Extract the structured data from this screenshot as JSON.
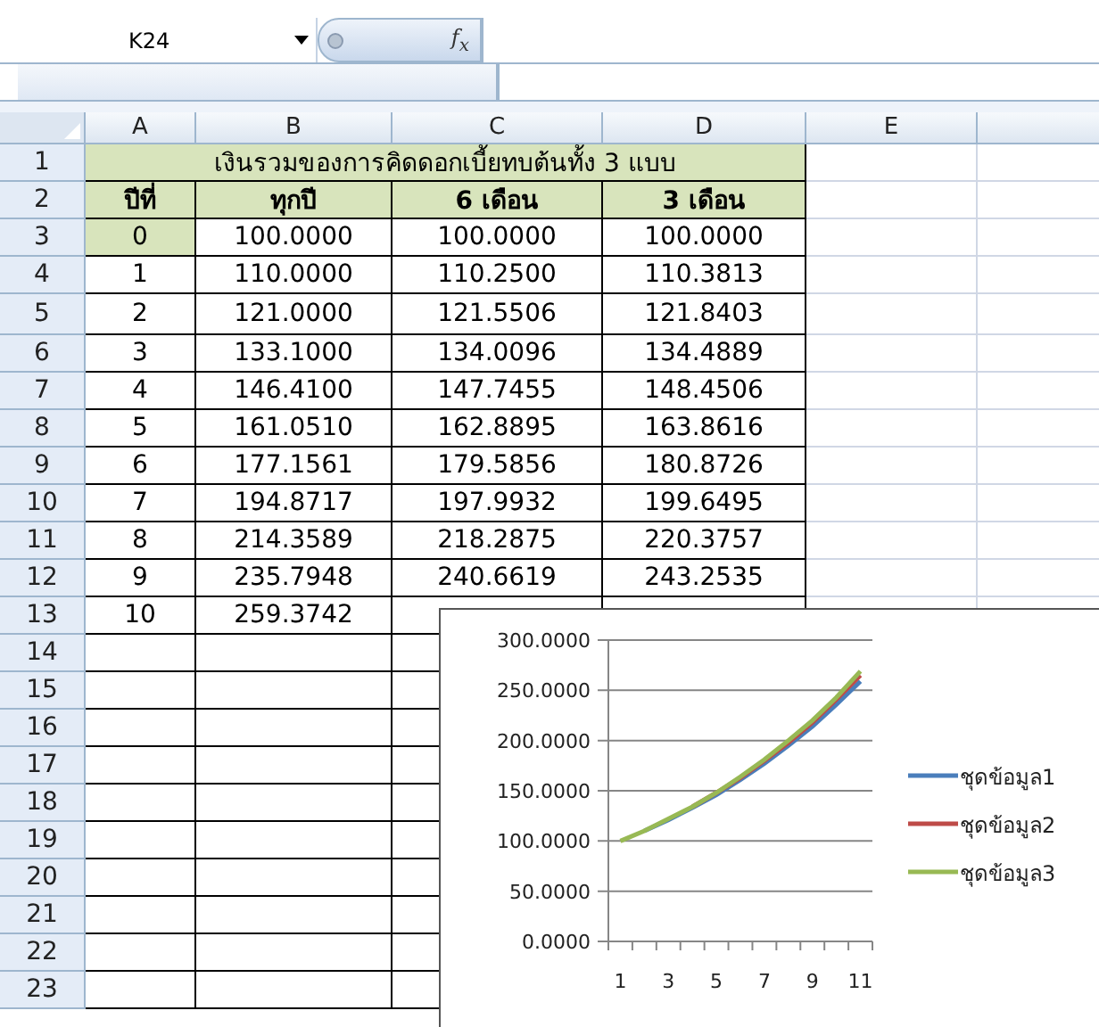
{
  "formula_bar": {
    "name_box": "K24",
    "fx": "f$_{x}$"
  },
  "columns": [
    "A",
    "B",
    "C",
    "D",
    "E",
    ""
  ],
  "rows": [
    {
      "number": "1",
      "kind": "title",
      "title": "เงินรวมของการคิดดอกเบี้ยทบต้นทั้ง 3 แบบ"
    },
    {
      "number": "2",
      "kind": "header",
      "cells": [
        {
          "text": "ปีที่",
          "shaded": true
        },
        {
          "text": "ทุกปี",
          "shaded": true
        },
        {
          "text": "6 เดือน",
          "shaded": true
        },
        {
          "text": "3 เดือน",
          "shaded": true
        }
      ]
    },
    {
      "number": "3",
      "kind": "data",
      "cells": [
        {
          "text": "0",
          "shaded": true
        },
        {
          "text": "100.0000",
          "shaded": false
        },
        {
          "text": "100.0000",
          "shaded": false
        },
        {
          "text": "100.0000",
          "shaded": false
        }
      ]
    },
    {
      "number": "4",
      "kind": "data",
      "cells": [
        {
          "text": "1",
          "shaded": false
        },
        {
          "text": "110.0000",
          "shaded": false
        },
        {
          "text": "110.2500",
          "shaded": false
        },
        {
          "text": "110.3813",
          "shaded": false
        }
      ]
    },
    {
      "number": "5",
      "kind": "data",
      "tall": true,
      "cells": [
        {
          "text": "2",
          "shaded": false
        },
        {
          "text": "121.0000",
          "shaded": false
        },
        {
          "text": "121.5506",
          "shaded": false
        },
        {
          "text": "121.8403",
          "shaded": false
        }
      ]
    },
    {
      "number": "6",
      "kind": "data",
      "cells": [
        {
          "text": "3",
          "shaded": false
        },
        {
          "text": "133.1000",
          "shaded": false
        },
        {
          "text": "134.0096",
          "shaded": false
        },
        {
          "text": "134.4889",
          "shaded": false
        }
      ]
    },
    {
      "number": "7",
      "kind": "data",
      "cells": [
        {
          "text": "4",
          "shaded": false
        },
        {
          "text": "146.4100",
          "shaded": false
        },
        {
          "text": "147.7455",
          "shaded": false
        },
        {
          "text": "148.4506",
          "shaded": false
        }
      ]
    },
    {
      "number": "8",
      "kind": "data",
      "cells": [
        {
          "text": "5",
          "shaded": false
        },
        {
          "text": "161.0510",
          "shaded": false
        },
        {
          "text": "162.8895",
          "shaded": false
        },
        {
          "text": "163.8616",
          "shaded": false
        }
      ]
    },
    {
      "number": "9",
      "kind": "data",
      "cells": [
        {
          "text": "6",
          "shaded": false
        },
        {
          "text": "177.1561",
          "shaded": false
        },
        {
          "text": "179.5856",
          "shaded": false
        },
        {
          "text": "180.8726",
          "shaded": false
        }
      ]
    },
    {
      "number": "10",
      "kind": "data",
      "cells": [
        {
          "text": "7",
          "shaded": false
        },
        {
          "text": "194.8717",
          "shaded": false
        },
        {
          "text": "197.9932",
          "shaded": false
        },
        {
          "text": "199.6495",
          "shaded": false
        }
      ]
    },
    {
      "number": "11",
      "kind": "data",
      "cells": [
        {
          "text": "8",
          "shaded": false
        },
        {
          "text": "214.3589",
          "shaded": false
        },
        {
          "text": "218.2875",
          "shaded": false
        },
        {
          "text": "220.3757",
          "shaded": false
        }
      ]
    },
    {
      "number": "12",
      "kind": "data",
      "cells": [
        {
          "text": "9",
          "shaded": false
        },
        {
          "text": "235.7948",
          "shaded": false
        },
        {
          "text": "240.6619",
          "shaded": false
        },
        {
          "text": "243.2535",
          "shaded": false
        }
      ]
    },
    {
      "number": "13",
      "kind": "data",
      "cells": [
        {
          "text": "10",
          "shaded": false
        },
        {
          "text": "259.3742",
          "shaded": false
        }
      ]
    },
    {
      "number": "14",
      "kind": "empty"
    },
    {
      "number": "15",
      "kind": "empty"
    },
    {
      "number": "16",
      "kind": "empty"
    },
    {
      "number": "17",
      "kind": "empty"
    },
    {
      "number": "18",
      "kind": "empty"
    },
    {
      "number": "19",
      "kind": "empty"
    },
    {
      "number": "20",
      "kind": "empty"
    },
    {
      "number": "21",
      "kind": "empty"
    },
    {
      "number": "22",
      "kind": "empty"
    },
    {
      "number": "23",
      "kind": "empty"
    }
  ],
  "chart": {
    "chart_data": {
      "type": "line",
      "categories": [
        "1",
        null,
        "3",
        null,
        "5",
        null,
        "7",
        null,
        "9",
        null,
        "11"
      ],
      "ylim": [
        0,
        300
      ],
      "grid": true,
      "legend": "right",
      "yticks": [
        {
          "value": 0,
          "label": "0.0000"
        },
        {
          "value": 50,
          "label": "50.0000"
        },
        {
          "value": 100,
          "label": "100.0000"
        },
        {
          "value": 150,
          "label": "150.0000"
        },
        {
          "value": 200,
          "label": "200.0000"
        },
        {
          "value": 250,
          "label": "250.0000"
        },
        {
          "value": 300,
          "label": "300.0000"
        }
      ],
      "series": [
        {
          "name": "ชุดข้อมูล1",
          "color": "#4a7ebb",
          "values": [
            null,
            110,
            121,
            133,
            146,
            161,
            177,
            195,
            214,
            236,
            259
          ]
        },
        {
          "name": "ชุดข้อมูล2",
          "color": "#be4b48",
          "values": [
            null,
            null,
            null,
            134,
            148,
            163,
            180,
            198,
            218,
            241,
            265
          ]
        },
        {
          "name": "ชุดข้อมูล3",
          "color": "#98b954",
          "values": [
            100,
            110,
            122,
            134,
            148,
            164,
            181,
            200,
            220,
            243,
            269
          ]
        }
      ]
    }
  }
}
